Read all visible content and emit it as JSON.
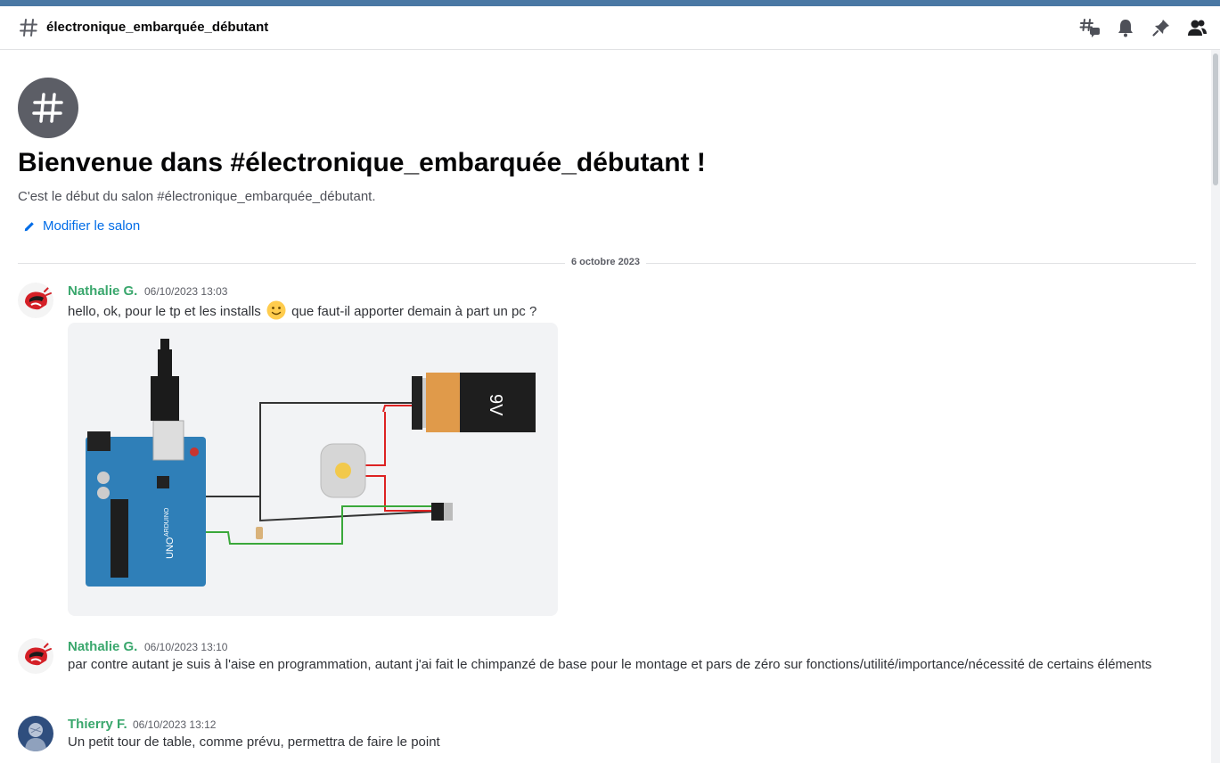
{
  "header": {
    "channel_name": "électronique_embarquée_débutant",
    "icons": [
      "threads-icon",
      "bell-icon",
      "pin-icon",
      "members-icon"
    ]
  },
  "welcome": {
    "title": "Bienvenue dans #électronique_embarquée_débutant !",
    "subtitle": "C'est le début du salon #électronique_embarquée_débutant.",
    "edit_label": "Modifier le salon"
  },
  "divider": {
    "date": "6 octobre 2023"
  },
  "messages": [
    {
      "author": "Nathalie G.",
      "timestamp": "06/10/2023 13:03",
      "text_before": "hello, ok, pour le tp et les installs",
      "text_after": "que faut-il apporter demain à part un pc ?",
      "attachment": {
        "battery_label": "9V",
        "board_labels": [
          "UNO",
          "ARDUINO"
        ]
      }
    },
    {
      "author": "Nathalie G.",
      "timestamp": "06/10/2023 13:10",
      "text": "par contre autant je suis à l'aise en programmation, autant j'ai fait le chimpanzé de base pour le montage et pars de zéro sur fonctions/utilité/importance/nécessité de certains éléments"
    },
    {
      "author": "Thierry F.",
      "timestamp": "06/10/2023 13:12",
      "text": "Un petit tour de table, comme prévu, permettra de faire le point"
    }
  ],
  "colors": {
    "accent_top": "#4a78a4",
    "author_green": "#3aa76d",
    "link_blue": "#006ce7"
  }
}
